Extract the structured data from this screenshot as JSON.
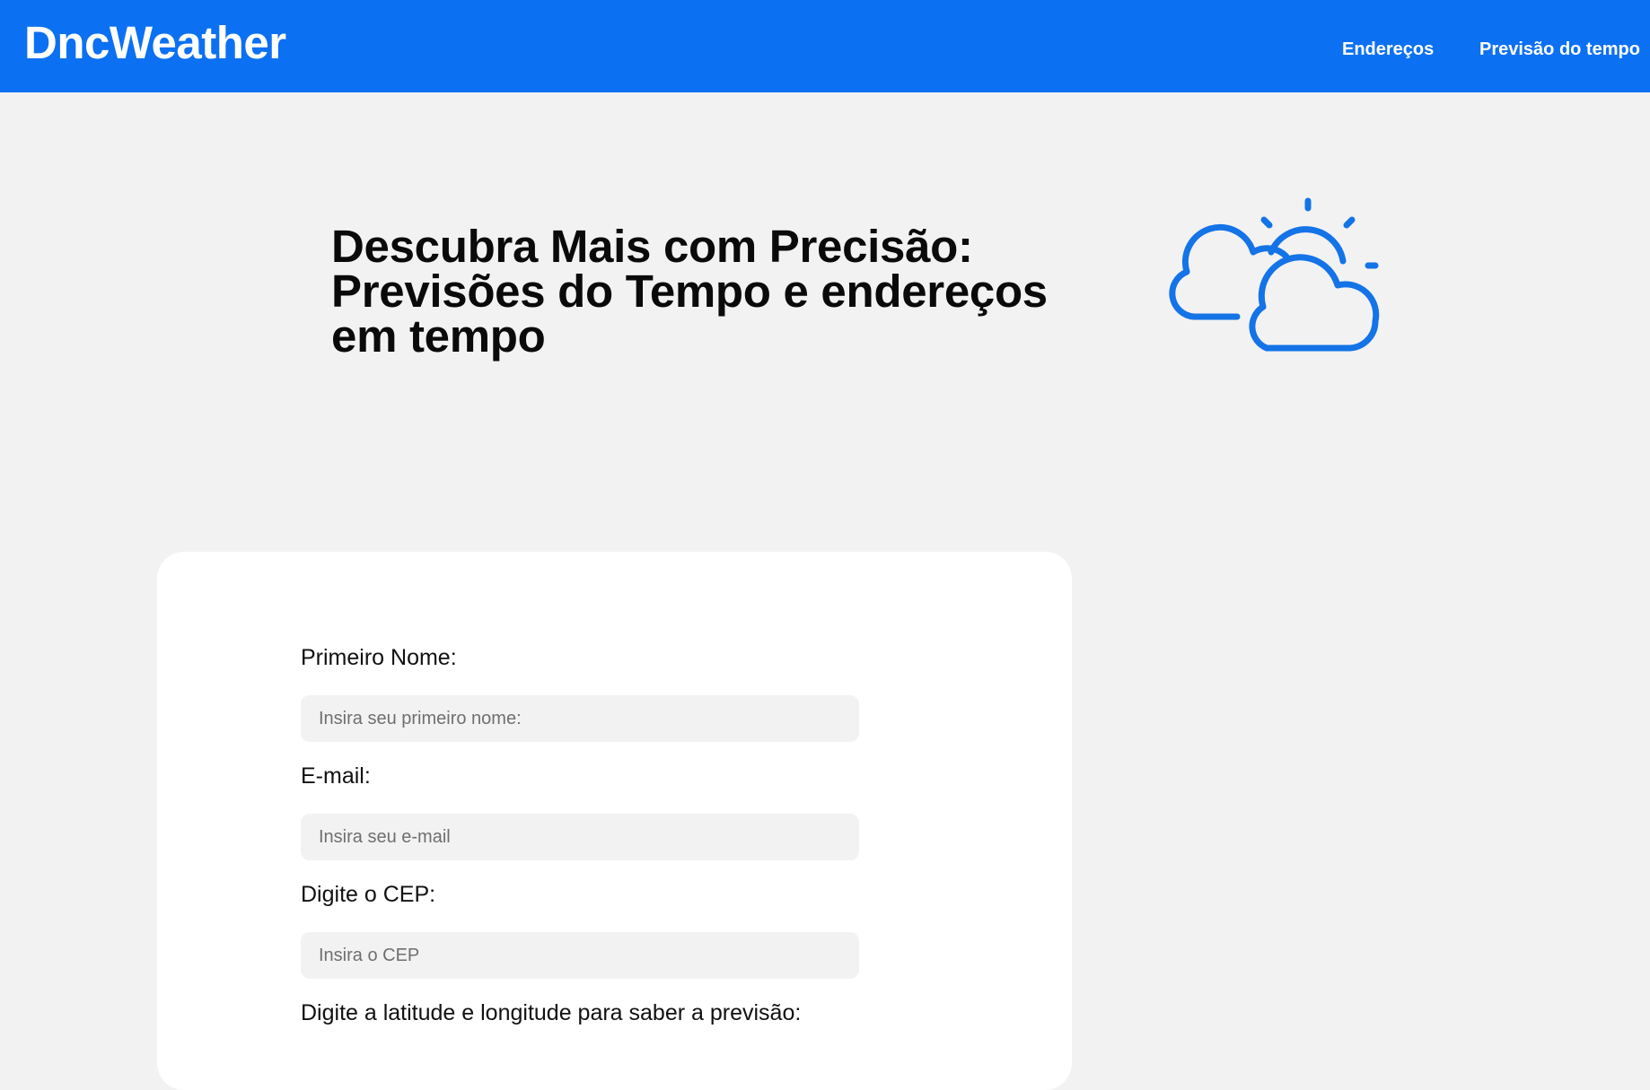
{
  "header": {
    "logo": "DncWeather",
    "nav": [
      {
        "label": "Endereços"
      },
      {
        "label": "Previsão do tempo"
      }
    ],
    "background_color": "#0c70f2"
  },
  "hero": {
    "title_lines": [
      "Descubra Mais com Precisão:",
      "Previsões do Tempo e endereços",
      "em tempo"
    ],
    "icon": "cloud-sun-icon",
    "icon_color": "#1473e6"
  },
  "form": {
    "first_name": {
      "label": "Primeiro Nome:",
      "placeholder": "Insira seu primeiro nome:",
      "value": ""
    },
    "email": {
      "label": "E-mail:",
      "placeholder": "Insira seu e-mail",
      "value": ""
    },
    "cep": {
      "label": "Digite o CEP:",
      "placeholder": "Insira o CEP",
      "value": ""
    },
    "coords": {
      "label": "Digite a latitude e longitude para saber a previsão:"
    }
  }
}
